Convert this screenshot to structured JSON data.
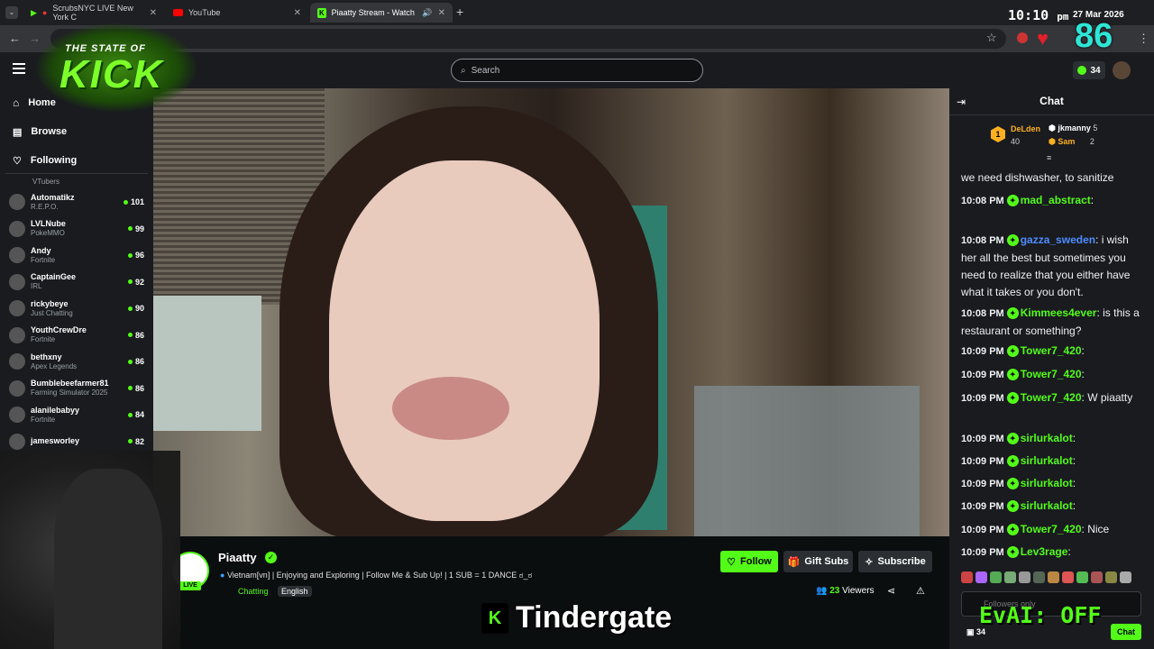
{
  "browser": {
    "tabs": [
      {
        "label": "ScrubsNYC LIVE New York C",
        "active": false
      },
      {
        "label": "YouTube",
        "active": false
      },
      {
        "label": "Piaatty Stream - Watch Live",
        "active": true
      }
    ],
    "new_tab": "+"
  },
  "overlay": {
    "logo_top": "THE STATE OF",
    "logo_main": "KICK",
    "clock_time": "10:10",
    "clock_ampm": "pm",
    "clock_date": "27 Mar 2026",
    "big_number": "86",
    "caption": "Tindergate",
    "caption_icon": "K",
    "evai": "EvAI: OFF"
  },
  "header": {
    "search_placeholder": "Search",
    "points": "34"
  },
  "sidebar": {
    "nav": [
      {
        "label": "Home",
        "icon": "home-icon"
      },
      {
        "label": "Browse",
        "icon": "browse-icon"
      },
      {
        "label": "Following",
        "icon": "heart-icon"
      }
    ],
    "partial_category": "VTubers",
    "channels": [
      {
        "name": "Automatikz",
        "game": "R.E.P.O.",
        "viewers": "101"
      },
      {
        "name": "LVLNube",
        "game": "PokeMMO",
        "viewers": "99"
      },
      {
        "name": "Andy",
        "game": "Fortnite",
        "viewers": "96"
      },
      {
        "name": "CaptainGee",
        "game": "IRL",
        "viewers": "92"
      },
      {
        "name": "rickybeye",
        "game": "Just Chatting",
        "viewers": "90"
      },
      {
        "name": "YouthCrewDre",
        "game": "Fortnite",
        "viewers": "86"
      },
      {
        "name": "bethxny",
        "game": "Apex Legends",
        "viewers": "86"
      },
      {
        "name": "Bumblebeefarmer81",
        "game": "Farming Simulator 2025",
        "viewers": "86"
      },
      {
        "name": "alanilebabyy",
        "game": "Fortnite",
        "viewers": "84"
      },
      {
        "name": "jamesworley",
        "game": "",
        "viewers": "82"
      }
    ]
  },
  "stream": {
    "streamer": "Piaatty",
    "live_badge": "LIVE",
    "title": "Vietnam[vn] | Enjoying and Exploring | Follow Me & Sub Up! | 1 SUB = 1 DANCE ಠ_ಠ",
    "category": "Chatting",
    "language": "English",
    "viewers_count": "23",
    "viewers_label": "Viewers",
    "follow_label": "Follow",
    "gift_label": "Gift Subs",
    "subscribe_label": "Subscribe"
  },
  "chat": {
    "title": "Chat",
    "leaderboard": [
      {
        "name": "DeLden",
        "value": "40",
        "color": "#ffb020"
      },
      {
        "name": "jkmanny",
        "value": "5",
        "color": "#e6e6e6"
      },
      {
        "name": "Sam",
        "value": "2",
        "color": "#ffb020"
      }
    ],
    "messages": [
      {
        "time": "",
        "user": "",
        "color": "#ffffff",
        "text": "we need dishwasher, to sanitize"
      },
      {
        "time": "10:08 PM",
        "user": "mad_abstract",
        "color": "#53fc18",
        "text": ""
      },
      {
        "time": "10:08 PM",
        "user": "gazza_sweden",
        "color": "#4f8cff",
        "text": "i wish her all the best but sometimes you need to realize that you either have what it takes or you don't."
      },
      {
        "time": "10:08 PM",
        "user": "Kimmees4ever",
        "color": "#53fc18",
        "text": "is this a restaurant or something?"
      },
      {
        "time": "10:09 PM",
        "user": "Tower7_420",
        "color": "#53fc18",
        "text": ""
      },
      {
        "time": "10:09 PM",
        "user": "Tower7_420",
        "color": "#53fc18",
        "text": ""
      },
      {
        "time": "10:09 PM",
        "user": "Tower7_420",
        "color": "#53fc18",
        "text": "W piaatty"
      },
      {
        "time": "10:09 PM",
        "user": "sirlurkalot",
        "color": "#53fc18",
        "text": ""
      },
      {
        "time": "10:09 PM",
        "user": "sirlurkalot",
        "color": "#53fc18",
        "text": ""
      },
      {
        "time": "10:09 PM",
        "user": "sirlurkalot",
        "color": "#53fc18",
        "text": ""
      },
      {
        "time": "10:09 PM",
        "user": "sirlurkalot",
        "color": "#53fc18",
        "text": ""
      },
      {
        "time": "10:09 PM",
        "user": "Tower7_420",
        "color": "#53fc18",
        "text": "Nice"
      },
      {
        "time": "10:09 PM",
        "user": "Lev3rage",
        "color": "#53fc18",
        "text": ""
      }
    ],
    "input_placeholder": "Followers only",
    "points": "34",
    "chat_button": "Chat"
  },
  "colors": {
    "kick_green": "#53fc18",
    "bg": "#0b0e0f",
    "panel": "#191b1f"
  }
}
